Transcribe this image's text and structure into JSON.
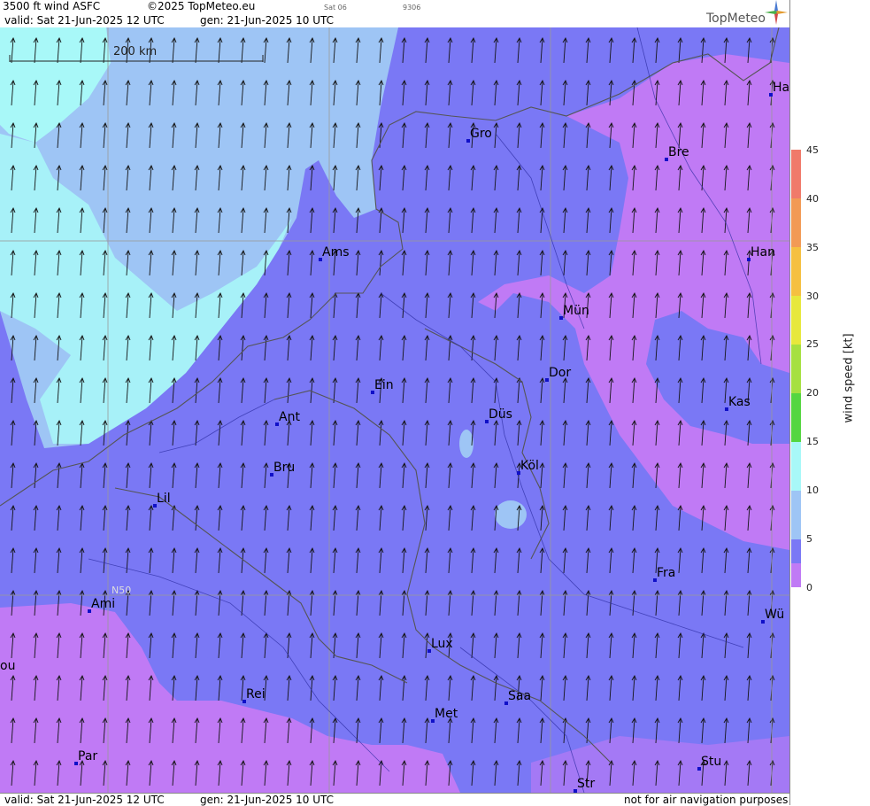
{
  "header": {
    "title": "3500 ft wind ASFC",
    "copyright": "©2025 TopMeteo.eu",
    "day_short": "Sat 06",
    "code": "9306",
    "valid": "valid:  Sat  21-Jun-2025  12 UTC",
    "gen": "gen: 21-Jun-2025 10 UTC",
    "logo": "TopMeteo"
  },
  "footer": {
    "valid": "valid:  Sat  21-Jun-2025  12 UTC",
    "gen": "gen: 21-Jun-2025 10 UTC",
    "disclaimer": "not for air navigation purposes"
  },
  "map": {
    "scale_label": "200 km",
    "graticule_label": "N50",
    "cities": [
      {
        "name": "Ha"
      },
      {
        "name": "Gro"
      },
      {
        "name": "Bre"
      },
      {
        "name": "Ams"
      },
      {
        "name": "Han"
      },
      {
        "name": "Mün"
      },
      {
        "name": "Ein"
      },
      {
        "name": "Dor"
      },
      {
        "name": "Kas"
      },
      {
        "name": "Ant"
      },
      {
        "name": "Düs"
      },
      {
        "name": "Bru"
      },
      {
        "name": "Köl"
      },
      {
        "name": "Lil"
      },
      {
        "name": "Fra"
      },
      {
        "name": "Ami"
      },
      {
        "name": "Wü"
      },
      {
        "name": "ou"
      },
      {
        "name": "Lux"
      },
      {
        "name": "Rei"
      },
      {
        "name": "Saa"
      },
      {
        "name": "Met"
      },
      {
        "name": "Par"
      },
      {
        "name": "Stu"
      },
      {
        "name": "Str"
      }
    ],
    "wind_direction": "southerly / south-southwest"
  },
  "legend": {
    "label": "wind speed [kt]",
    "ticks": [
      "45",
      "40",
      "35",
      "30",
      "25",
      "20",
      "15",
      "10",
      "5",
      "0"
    ],
    "colors": [
      "#f07a6a",
      "#f29a55",
      "#f5c040",
      "#e7e83c",
      "#a6e040",
      "#55d640",
      "#a8f8f8",
      "#9ec5f5",
      "#7a78f5",
      "#c07af5"
    ]
  },
  "colors": {
    "calm": "#c07af5",
    "light": "#7a78f5",
    "moderate": "#9ec5f5",
    "fresh": "#a8f8f8"
  }
}
